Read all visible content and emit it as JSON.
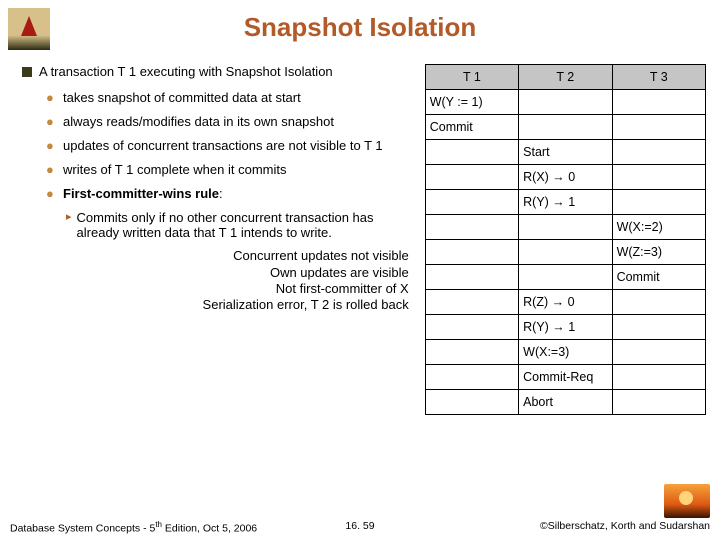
{
  "title": "Snapshot Isolation",
  "main": {
    "intro": "A transaction T 1 executing with Snapshot Isolation",
    "bullets": {
      "b1": "takes snapshot of committed data at start",
      "b2": "always reads/modifies data in its own snapshot",
      "b3": "updates of concurrent transactions are not visible to T 1",
      "b4": "writes of T 1 complete when it commits",
      "b5_label": "First-committer-wins rule",
      "b5_colon": ":",
      "sub1": "Commits only if no other concurrent transaction has already written data that T 1 intends to write."
    },
    "notes": {
      "l1": "Concurrent updates not visible",
      "l2": "Own updates are visible",
      "l3": "Not first-committer of X",
      "l4": "Serialization error, T 2 is rolled back"
    }
  },
  "table": {
    "headers": {
      "t1": "T 1",
      "t2": "T 2",
      "t3": "T 3"
    },
    "rows": [
      {
        "c1": "W(Y := 1)",
        "c2": "",
        "c3": ""
      },
      {
        "c1": "Commit",
        "c2": "",
        "c3": ""
      },
      {
        "c1": "",
        "c2": "Start",
        "c3": ""
      },
      {
        "c1": "",
        "c2": "R(X) → 0",
        "c3": ""
      },
      {
        "c1": "",
        "c2": "R(Y) → 1",
        "c3": ""
      },
      {
        "c1": "",
        "c2": "",
        "c3": "W(X:=2)"
      },
      {
        "c1": "",
        "c2": "",
        "c3": "W(Z:=3)"
      },
      {
        "c1": "",
        "c2": "",
        "c3": "Commit"
      },
      {
        "c1": "",
        "c2": "R(Z) → 0",
        "c3": ""
      },
      {
        "c1": "",
        "c2": "R(Y) → 1",
        "c3": ""
      },
      {
        "c1": "",
        "c2": "W(X:=3)",
        "c3": ""
      },
      {
        "c1": "",
        "c2": "Commit-Req",
        "c3": ""
      },
      {
        "c1": "",
        "c2": "Abort",
        "c3": ""
      }
    ]
  },
  "footer": {
    "left_a": "Database System Concepts - 5",
    "left_sup": "th",
    "left_b": " Edition, Oct 5, 2006",
    "center": "16. 59",
    "right": "©Silberschatz, Korth and Sudarshan"
  }
}
